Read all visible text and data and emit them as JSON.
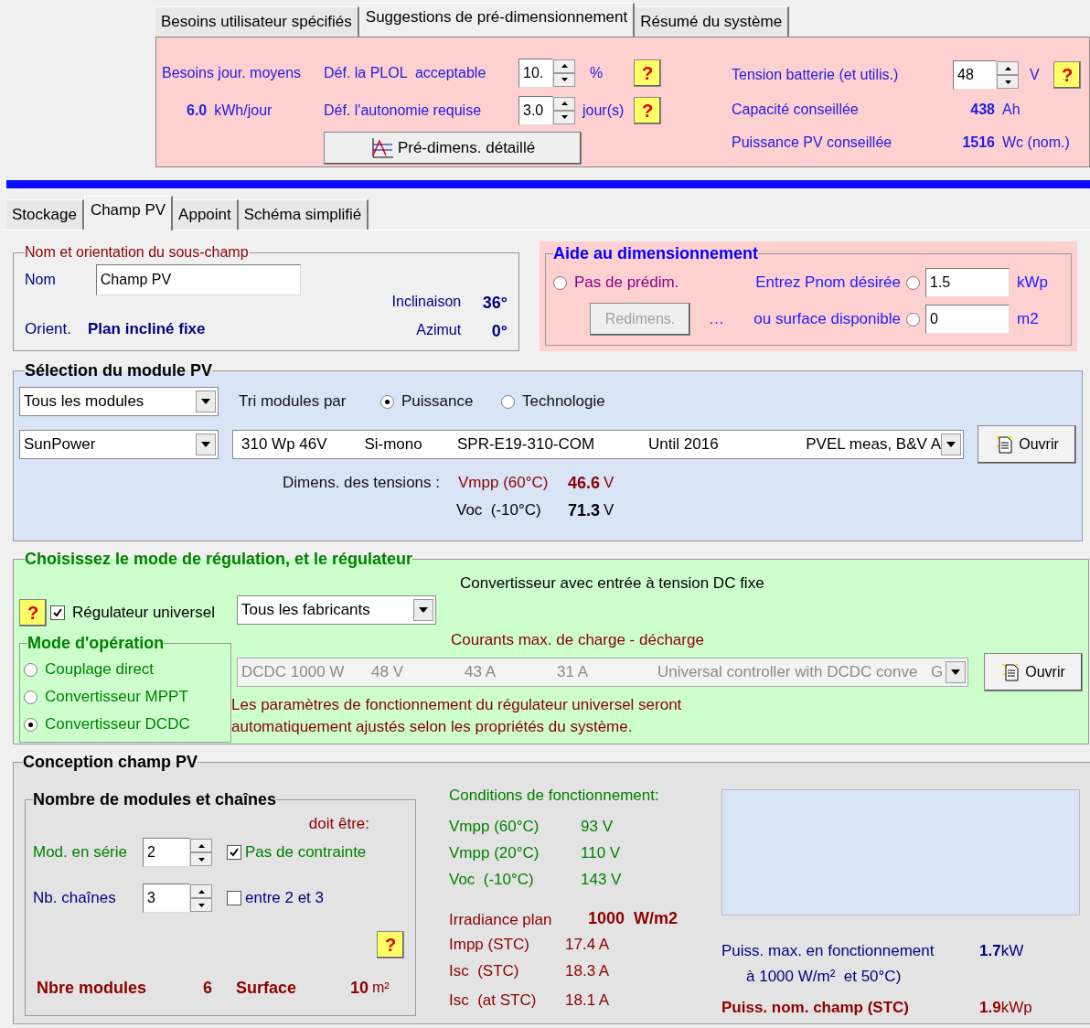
{
  "top_tabs": [
    {
      "label": "Besoins utilisateur spécifiés",
      "selected": false
    },
    {
      "label": "Suggestions de pré-dimensionnement",
      "selected": true
    },
    {
      "label": "Résumé du système",
      "selected": false
    }
  ],
  "presizing": {
    "daily_label": "Besoins jour. moyens",
    "daily_value": "6.0",
    "daily_unit": "kWh/jour",
    "plol_label": "Déf. la PLOL  acceptable",
    "plol_value": "10.",
    "plol_unit": "%",
    "plol_help": "?",
    "autonomy_label": "Déf. l'autonomie requise",
    "autonomy_value": "3.0",
    "autonomy_unit": "jour(s)",
    "autonomy_help": "?",
    "detail_button": "Pré-dimens. détaillé",
    "voltage_label": "Tension batterie (et utilis.)",
    "voltage_value": "48",
    "voltage_unit": "V",
    "voltage_help": "?",
    "capacity_label": "Capacité conseillée",
    "capacity_value": "438",
    "capacity_unit": "Ah",
    "pv_label": "Puissance PV conseillée",
    "pv_value": "1516",
    "pv_unit": "Wc (nom.)"
  },
  "tabs": [
    {
      "label": "Stockage",
      "selected": false
    },
    {
      "label": "Champ PV",
      "selected": true
    },
    {
      "label": "Appoint",
      "selected": false
    },
    {
      "label": "Schéma simplifié",
      "selected": false
    }
  ],
  "subfield": {
    "title": "Nom et orientation du sous-champ",
    "name_label": "Nom",
    "name_value": "Champ PV",
    "orient_label": "Orient.",
    "orient_value": "Plan incliné fixe",
    "tilt_label": "Inclinaison",
    "tilt_value": "36°",
    "azimuth_label": "Azimut",
    "azimuth_value": "0°"
  },
  "sizing_help": {
    "title": "Aide au dimensionnement",
    "no_presize": {
      "label": "Pas de prédim.",
      "selected": false
    },
    "pnom": {
      "label": "Entrez Pnom désirée",
      "selected": false,
      "value": "1.5",
      "unit": "kWp"
    },
    "surface": {
      "prefix": "…",
      "label": "ou surface disponible",
      "selected": false,
      "value": "0",
      "unit": "m2"
    },
    "redimens_button": {
      "label": "Redimens.",
      "disabled": true
    }
  },
  "module_selection": {
    "title": "Sélection du module PV",
    "filter_value": "Tous les modules",
    "sort_label": "Tri modules par",
    "sort_options": [
      {
        "label": "Puissance",
        "selected": true
      },
      {
        "label": "Technologie",
        "selected": false
      }
    ],
    "manufacturer_value": "SunPower",
    "module_columns": [
      "310 Wp 46V",
      "Si-mono",
      "SPR-E19-310-COM",
      "Until 2016",
      "PVEL meas, B&V A"
    ],
    "open_button": "Ouvrir",
    "voltage_label": "Dimens. des tensions :",
    "vmpp_label": "Vmpp (60°C)",
    "vmpp_value": "46.6",
    "vmpp_unit": "V",
    "voc_label": "Voc  (-10°C)",
    "voc_value": "71.3",
    "voc_unit": "V"
  },
  "regulation": {
    "title": "Choisissez le mode de régulation, et le régulateur",
    "help": "?",
    "universal": {
      "label": "Régulateur universel",
      "checked": true
    },
    "manufacturer_value": "Tous les fabricants",
    "converter_note": "Convertisseur avec entrée à tension DC fixe",
    "currents_label": "Courants max. de charge - décharge",
    "mode_title": "Mode d'opération",
    "modes": [
      {
        "label": "Couplage direct",
        "selected": false
      },
      {
        "label": "Convertisseur MPPT",
        "selected": false
      },
      {
        "label": "Convertisseur DCDC",
        "selected": true
      }
    ],
    "controller_columns": [
      "DCDC 1000 W",
      "48 V",
      "43 A",
      "31 A",
      "Universal controller with DCDC conve",
      "G"
    ],
    "controller_disabled": true,
    "open_button": "Ouvrir",
    "info": "Les paramètres de fonctionnement du régulateur universel seront\nautomatiquement ajustés selon les propriétés du système."
  },
  "design": {
    "title": "Conception champ PV",
    "strings": {
      "title": "Nombre de modules et chaînes",
      "must_be": "doit être:",
      "series_label": "Mod. en série",
      "series_value": "2",
      "no_constraint": {
        "label": "Pas de contrainte",
        "checked": true
      },
      "strings_label": "Nb. chaînes",
      "strings_value": "3",
      "range": {
        "label": "entre 2 et 3",
        "checked": false
      },
      "help": "?",
      "total_label": "Nbre modules",
      "total_value": "6",
      "surface_label": "Surface",
      "surface_value": "10",
      "surface_unit": "m²"
    },
    "conditions_title": "Conditions de fonctionnement:",
    "conditions": [
      {
        "label": "Vmpp (60°C)",
        "value": "93 V"
      },
      {
        "label": "Vmpp (20°C)",
        "value": "110 V"
      },
      {
        "label": "Voc  (-10°C)",
        "value": "143 V"
      }
    ],
    "irradiance_label": "Irradiance plan",
    "irradiance_value": "1000  W/m2",
    "currents": [
      {
        "label": "Impp (STC)",
        "value": "17.4 A"
      },
      {
        "label": "Isc  (STC)",
        "value": "18.3 A"
      },
      {
        "label": "Isc  (at STC)",
        "value": "18.1 A"
      }
    ],
    "max_power_label": "Puiss. max. en fonctionnement",
    "max_power_sub": "à 1000 W/m²  et 50°C)",
    "max_power_value": "1.7",
    "max_power_unit": "kW",
    "nominal_label": "Puiss. nom. champ (STC)",
    "nominal_value": "1.9",
    "nominal_unit": "kWp"
  }
}
